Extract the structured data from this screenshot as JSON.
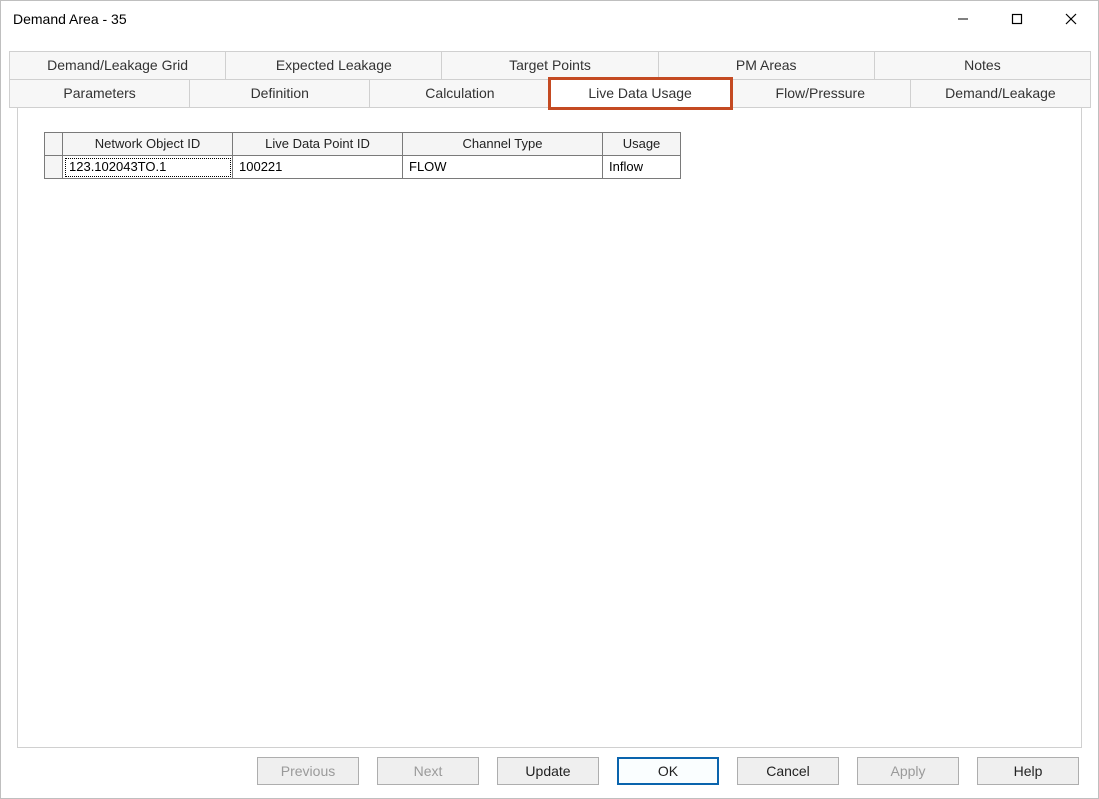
{
  "window": {
    "title": "Demand Area - 35"
  },
  "tabs": {
    "row1": [
      {
        "label": "Demand/Leakage Grid"
      },
      {
        "label": "Expected Leakage"
      },
      {
        "label": "Target Points"
      },
      {
        "label": "PM Areas"
      },
      {
        "label": "Notes"
      }
    ],
    "row2": [
      {
        "label": "Parameters"
      },
      {
        "label": "Definition"
      },
      {
        "label": "Calculation"
      },
      {
        "label": "Live Data Usage",
        "active": true,
        "highlighted": true
      },
      {
        "label": "Flow/Pressure"
      },
      {
        "label": "Demand/Leakage"
      }
    ]
  },
  "grid": {
    "headers": {
      "network_object_id": "Network Object ID",
      "live_data_point_id": "Live Data Point ID",
      "channel_type": "Channel Type",
      "usage": "Usage"
    },
    "rows": [
      {
        "network_object_id": "123.102043TO.1",
        "live_data_point_id": "100221",
        "channel_type": "FLOW",
        "usage": "Inflow"
      }
    ]
  },
  "buttons": {
    "previous": "Previous",
    "next": "Next",
    "update": "Update",
    "ok": "OK",
    "cancel": "Cancel",
    "apply": "Apply",
    "help": "Help"
  }
}
